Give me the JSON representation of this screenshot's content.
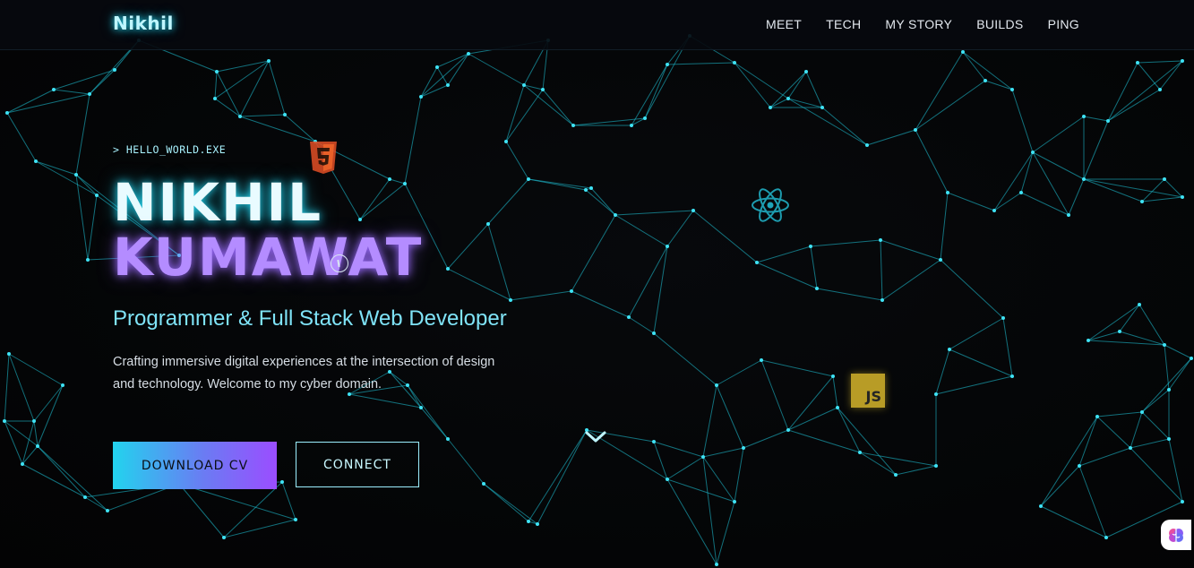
{
  "nav": {
    "brand": "Nikhil",
    "links": [
      "MEET",
      "TECH",
      "MY STORY",
      "BUILDS",
      "PING"
    ]
  },
  "hero": {
    "prompt": "> HELLO_WORLD.EXE",
    "first_name": "NIKHIL",
    "last_name": "KUMAWAT",
    "subtitle": "Programmer & Full Stack Web Developer",
    "description": "Crafting immersive digital experiences at the intersection of design and technology. Welcome to my cyber domain.",
    "primary_button": "DOWNLOAD CV",
    "secondary_button": "CONNECT"
  },
  "floating_icons": {
    "html5": "html5-icon",
    "react": "react-icon",
    "js": "JS"
  },
  "colors": {
    "background": "#050608",
    "accent_cyan": "#22d3ee",
    "accent_purple": "#9b6bff",
    "network_line": "#1fc9dd"
  }
}
